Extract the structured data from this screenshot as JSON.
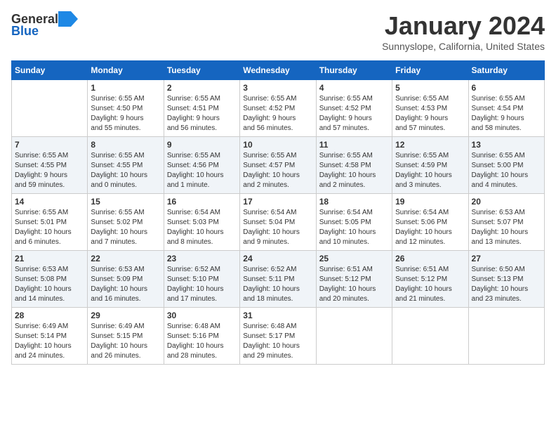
{
  "header": {
    "logo_general": "General",
    "logo_blue": "Blue",
    "month_title": "January 2024",
    "subtitle": "Sunnyslope, California, United States"
  },
  "weekdays": [
    "Sunday",
    "Monday",
    "Tuesday",
    "Wednesday",
    "Thursday",
    "Friday",
    "Saturday"
  ],
  "weeks": [
    [
      {
        "day": "",
        "info": ""
      },
      {
        "day": "1",
        "info": "Sunrise: 6:55 AM\nSunset: 4:50 PM\nDaylight: 9 hours\nand 55 minutes."
      },
      {
        "day": "2",
        "info": "Sunrise: 6:55 AM\nSunset: 4:51 PM\nDaylight: 9 hours\nand 56 minutes."
      },
      {
        "day": "3",
        "info": "Sunrise: 6:55 AM\nSunset: 4:52 PM\nDaylight: 9 hours\nand 56 minutes."
      },
      {
        "day": "4",
        "info": "Sunrise: 6:55 AM\nSunset: 4:52 PM\nDaylight: 9 hours\nand 57 minutes."
      },
      {
        "day": "5",
        "info": "Sunrise: 6:55 AM\nSunset: 4:53 PM\nDaylight: 9 hours\nand 57 minutes."
      },
      {
        "day": "6",
        "info": "Sunrise: 6:55 AM\nSunset: 4:54 PM\nDaylight: 9 hours\nand 58 minutes."
      }
    ],
    [
      {
        "day": "7",
        "info": "Sunrise: 6:55 AM\nSunset: 4:55 PM\nDaylight: 9 hours\nand 59 minutes."
      },
      {
        "day": "8",
        "info": "Sunrise: 6:55 AM\nSunset: 4:55 PM\nDaylight: 10 hours\nand 0 minutes."
      },
      {
        "day": "9",
        "info": "Sunrise: 6:55 AM\nSunset: 4:56 PM\nDaylight: 10 hours\nand 1 minute."
      },
      {
        "day": "10",
        "info": "Sunrise: 6:55 AM\nSunset: 4:57 PM\nDaylight: 10 hours\nand 2 minutes."
      },
      {
        "day": "11",
        "info": "Sunrise: 6:55 AM\nSunset: 4:58 PM\nDaylight: 10 hours\nand 2 minutes."
      },
      {
        "day": "12",
        "info": "Sunrise: 6:55 AM\nSunset: 4:59 PM\nDaylight: 10 hours\nand 3 minutes."
      },
      {
        "day": "13",
        "info": "Sunrise: 6:55 AM\nSunset: 5:00 PM\nDaylight: 10 hours\nand 4 minutes."
      }
    ],
    [
      {
        "day": "14",
        "info": "Sunrise: 6:55 AM\nSunset: 5:01 PM\nDaylight: 10 hours\nand 6 minutes."
      },
      {
        "day": "15",
        "info": "Sunrise: 6:55 AM\nSunset: 5:02 PM\nDaylight: 10 hours\nand 7 minutes."
      },
      {
        "day": "16",
        "info": "Sunrise: 6:54 AM\nSunset: 5:03 PM\nDaylight: 10 hours\nand 8 minutes."
      },
      {
        "day": "17",
        "info": "Sunrise: 6:54 AM\nSunset: 5:04 PM\nDaylight: 10 hours\nand 9 minutes."
      },
      {
        "day": "18",
        "info": "Sunrise: 6:54 AM\nSunset: 5:05 PM\nDaylight: 10 hours\nand 10 minutes."
      },
      {
        "day": "19",
        "info": "Sunrise: 6:54 AM\nSunset: 5:06 PM\nDaylight: 10 hours\nand 12 minutes."
      },
      {
        "day": "20",
        "info": "Sunrise: 6:53 AM\nSunset: 5:07 PM\nDaylight: 10 hours\nand 13 minutes."
      }
    ],
    [
      {
        "day": "21",
        "info": "Sunrise: 6:53 AM\nSunset: 5:08 PM\nDaylight: 10 hours\nand 14 minutes."
      },
      {
        "day": "22",
        "info": "Sunrise: 6:53 AM\nSunset: 5:09 PM\nDaylight: 10 hours\nand 16 minutes."
      },
      {
        "day": "23",
        "info": "Sunrise: 6:52 AM\nSunset: 5:10 PM\nDaylight: 10 hours\nand 17 minutes."
      },
      {
        "day": "24",
        "info": "Sunrise: 6:52 AM\nSunset: 5:11 PM\nDaylight: 10 hours\nand 18 minutes."
      },
      {
        "day": "25",
        "info": "Sunrise: 6:51 AM\nSunset: 5:12 PM\nDaylight: 10 hours\nand 20 minutes."
      },
      {
        "day": "26",
        "info": "Sunrise: 6:51 AM\nSunset: 5:12 PM\nDaylight: 10 hours\nand 21 minutes."
      },
      {
        "day": "27",
        "info": "Sunrise: 6:50 AM\nSunset: 5:13 PM\nDaylight: 10 hours\nand 23 minutes."
      }
    ],
    [
      {
        "day": "28",
        "info": "Sunrise: 6:49 AM\nSunset: 5:14 PM\nDaylight: 10 hours\nand 24 minutes."
      },
      {
        "day": "29",
        "info": "Sunrise: 6:49 AM\nSunset: 5:15 PM\nDaylight: 10 hours\nand 26 minutes."
      },
      {
        "day": "30",
        "info": "Sunrise: 6:48 AM\nSunset: 5:16 PM\nDaylight: 10 hours\nand 28 minutes."
      },
      {
        "day": "31",
        "info": "Sunrise: 6:48 AM\nSunset: 5:17 PM\nDaylight: 10 hours\nand 29 minutes."
      },
      {
        "day": "",
        "info": ""
      },
      {
        "day": "",
        "info": ""
      },
      {
        "day": "",
        "info": ""
      }
    ]
  ]
}
